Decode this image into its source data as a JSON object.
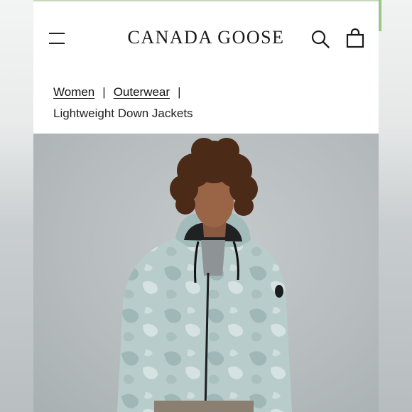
{
  "header": {
    "brand": "CANADA GOOSE",
    "menu_icon": "hamburger-menu-icon",
    "search_icon": "search-icon",
    "cart_icon": "shopping-bag-icon"
  },
  "breadcrumb": {
    "items": [
      "Women",
      "Outerwear",
      "Lightweight Down Jackets"
    ],
    "separator": "|"
  },
  "hero": {
    "image_subject": "model wearing light blue camo hooded down jacket"
  },
  "colors": {
    "accent": "#111111",
    "background": "#ffffff"
  }
}
